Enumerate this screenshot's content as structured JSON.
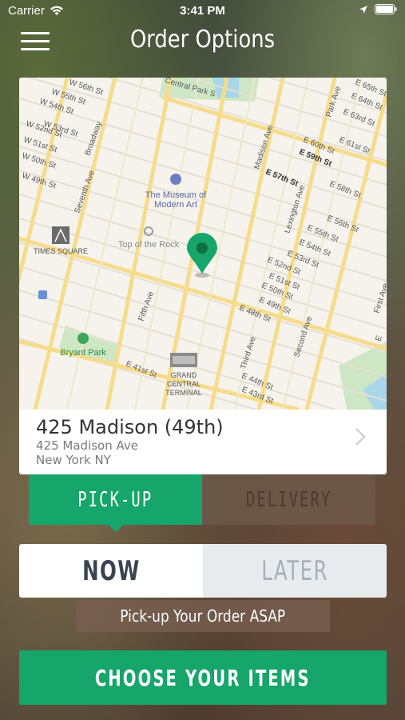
{
  "status_bar": {
    "carrier": "Carrier",
    "time": "3:41 PM"
  },
  "header": {
    "title": "Order Options",
    "menu_icon": "hamburger-menu-icon"
  },
  "map": {
    "labels": {
      "times_square": "TIMES SQUARE",
      "museum": "The Museum of Modern Art",
      "museum_line1": "The Museum of",
      "museum_line2": "Modern Art",
      "top_of_rock": "Top of the Rock",
      "bryant_park": "Bryant Park",
      "gct_line1": "GRAND",
      "gct_line2": "CENTRAL",
      "gct_line3": "TERMINAL",
      "streets": {
        "w56": "W 56th St",
        "w55": "W 55th St",
        "w54": "W 54th St",
        "w53": "W 53rd St",
        "w52": "W 52nd St",
        "w51": "W 51st St",
        "w50": "W 50th St",
        "w49": "W 49th St",
        "w57": "W 57th St",
        "central_park_s": "Central Park S",
        "madison": "Madison Ave",
        "park": "Park Ave",
        "e57": "E 57th St",
        "e59": "E 59th St",
        "e60": "E 60th St",
        "e61": "E 61st St",
        "e58": "E 58th St",
        "e56": "E 56th St",
        "e55": "E 55th St",
        "e54": "E 54th St",
        "e53": "E 53rd St",
        "e52": "E 52nd St",
        "e51": "E 51st St",
        "e50": "E 50th St",
        "e49": "E 49th St",
        "e48": "E 48th St",
        "e44": "E 44th St",
        "e43": "E 43rd St",
        "e41": "E 41st St",
        "e65": "E 65th St",
        "e64": "E 64th St",
        "e63": "E 63rd St",
        "lexington": "Lexington Ave",
        "third": "Third Ave",
        "second": "Second Ave",
        "first": "First Ave",
        "fifth": "Fifth Ave",
        "seventh": "Seventh Ave",
        "broadway": "Broadway",
        "e_partial": "E"
      }
    },
    "pin_color": "#16a56a"
  },
  "location": {
    "name": "425 Madison (49th)",
    "address_line1": "425 Madison Ave",
    "address_line2": "New York NY"
  },
  "order_type": {
    "pickup_label": "PICK-UP",
    "delivery_label": "DELIVERY",
    "selected": "PICK-UP"
  },
  "timing": {
    "now_label": "NOW",
    "later_label": "LATER",
    "selected": "NOW",
    "hint": "Pick-up Your Order ASAP"
  },
  "cta": {
    "label": "CHOOSE YOUR ITEMS"
  },
  "colors": {
    "accent": "#16a56a",
    "map_bg": "#f5f3ec",
    "road": "#f9e39a"
  }
}
